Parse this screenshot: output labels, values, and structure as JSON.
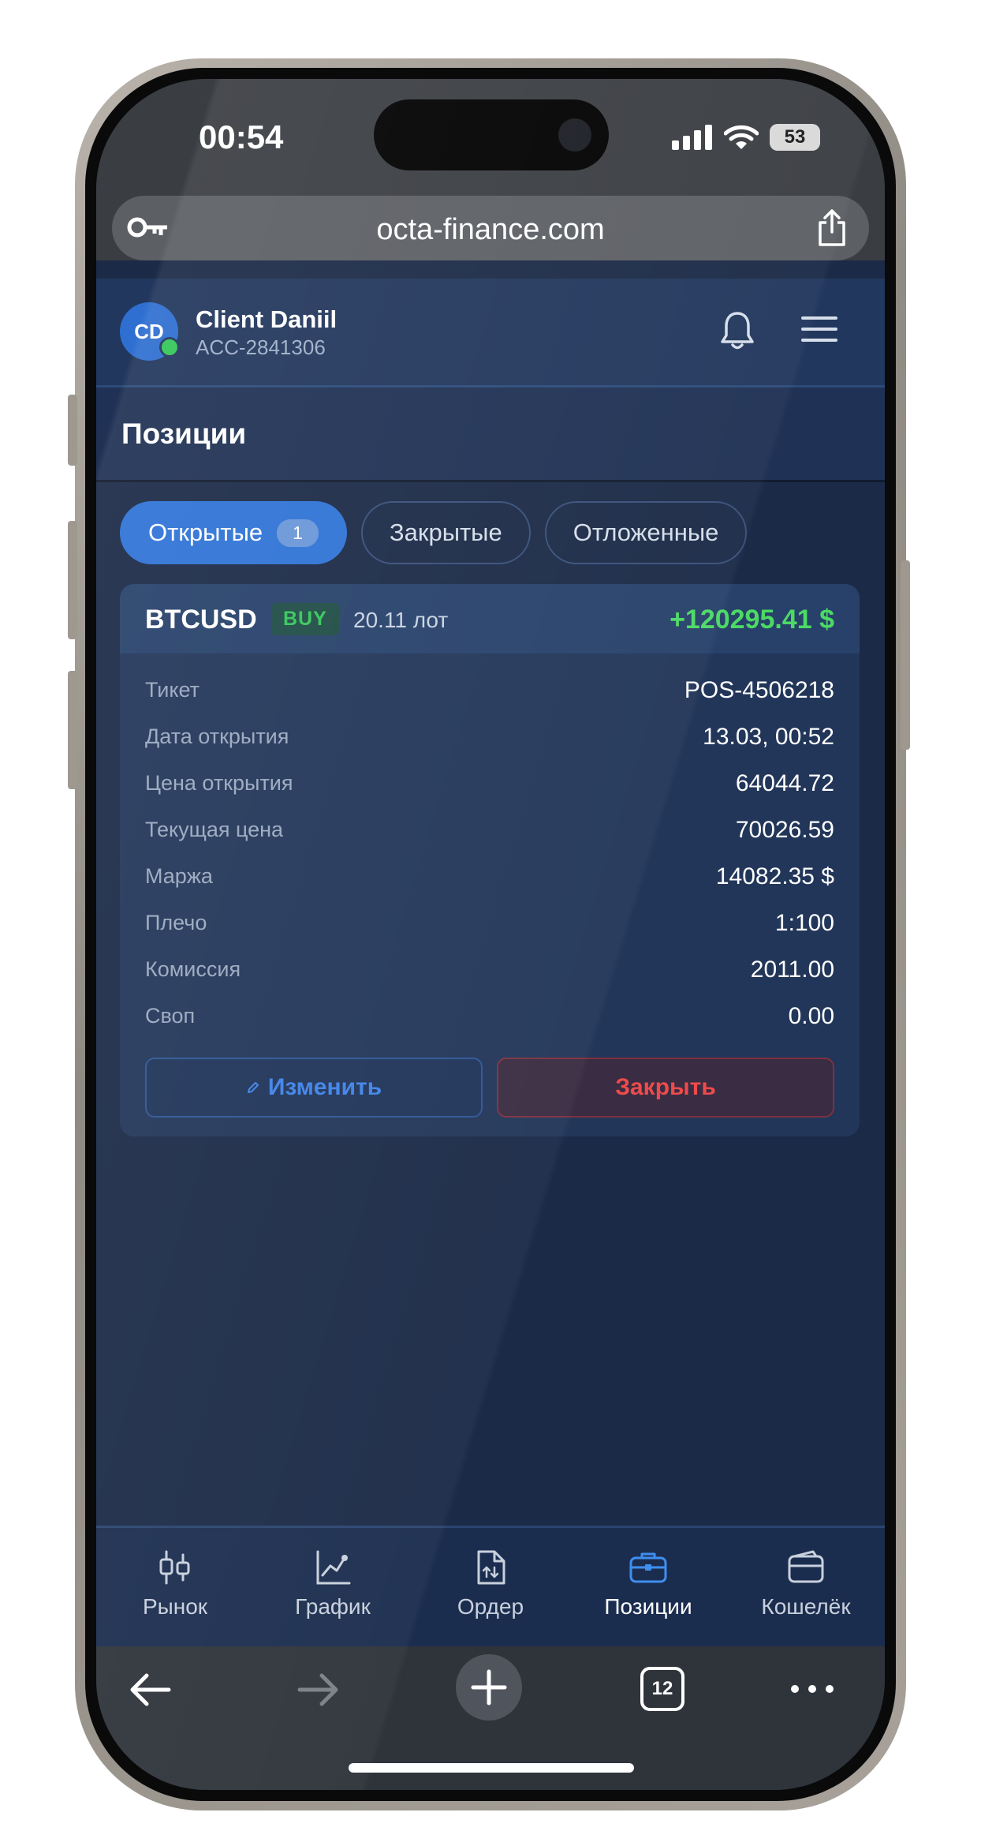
{
  "statusbar": {
    "time": "00:54",
    "battery": "53"
  },
  "browser": {
    "url": "octa-finance.com",
    "tabs_count": "12"
  },
  "header": {
    "avatar_initials": "CD",
    "user_name": "Client Daniil",
    "account_id": "ACC-2841306"
  },
  "page": {
    "title": "Позиции"
  },
  "tabs": [
    {
      "label": "Открытые",
      "badge": "1",
      "active": true
    },
    {
      "label": "Закрытые",
      "active": false
    },
    {
      "label": "Отложенные",
      "active": false
    }
  ],
  "position": {
    "symbol": "BTCUSD",
    "side": "BUY",
    "lots": "20.11 лот",
    "pnl": "+120295.41 $",
    "rows": [
      {
        "label": "Тикет",
        "value": "POS-4506218"
      },
      {
        "label": "Дата открытия",
        "value": "13.03, 00:52"
      },
      {
        "label": "Цена открытия",
        "value": "64044.72"
      },
      {
        "label": "Текущая цена",
        "value": "70026.59"
      },
      {
        "label": "Маржа",
        "value": "14082.35 $"
      },
      {
        "label": "Плечо",
        "value": "1:100"
      },
      {
        "label": "Комиссия",
        "value": "2011.00"
      },
      {
        "label": "Своп",
        "value": "0.00"
      }
    ],
    "edit_label": "Изменить",
    "close_label": "Закрыть"
  },
  "bottom_nav": [
    {
      "label": "Рынок",
      "icon": "candlestick-icon",
      "active": false
    },
    {
      "label": "График",
      "icon": "chart-line-icon",
      "active": false
    },
    {
      "label": "Ордер",
      "icon": "order-document-icon",
      "active": false
    },
    {
      "label": "Позиции",
      "icon": "briefcase-icon",
      "active": true
    },
    {
      "label": "Кошелёк",
      "icon": "wallet-icon",
      "active": false
    }
  ],
  "colors": {
    "accent": "#2f73d6",
    "profit": "#4cd964",
    "buy_badge": "#34c759",
    "close_red": "#ee4b4b",
    "background": "#1b2a47"
  }
}
